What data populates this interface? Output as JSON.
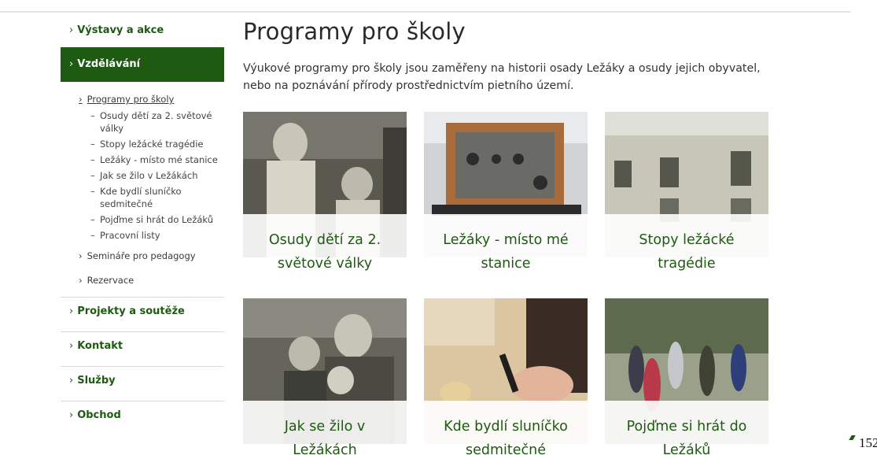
{
  "sidebar": {
    "items": [
      {
        "label": "Výstavy a akce"
      },
      {
        "label": "Vzdělávání"
      },
      {
        "label": "Projekty a soutěže"
      },
      {
        "label": "Kontakt"
      },
      {
        "label": "Služby"
      },
      {
        "label": "Obchod"
      }
    ],
    "sub": {
      "current": "Programy pro školy",
      "children": [
        "Osudy dětí za 2. světové války",
        "Stopy ležácké tragédie",
        "Ležáky - místo mé stanice",
        "Jak se žilo v Ležákách",
        "Kde bydlí sluníčko sedmitečné",
        "Pojďme si hrát do Ležáků",
        "Pracovní listy"
      ],
      "seminars": "Semináře pro pedagogy",
      "reservation": "Rezervace"
    },
    "chevron": "›"
  },
  "main": {
    "title": "Programy pro školy",
    "intro": "Výukové programy pro školy jsou zaměřeny na historii osady Ležáky a osudy jejich obyvatel, nebo na poznávání přírody prostřednictvím pietního území.",
    "cards": [
      {
        "title": "Osudy dětí za 2. světové války",
        "image": "vintage-photo-two-children"
      },
      {
        "title": "Ležáky - místo mé stanice",
        "image": "radio-transmitter-photo"
      },
      {
        "title": "Stopy ležácké tragédie",
        "image": "ruined-building-photo"
      },
      {
        "title": "Jak se žilo v Ležákách",
        "image": "vintage-family-photo"
      },
      {
        "title": "Kde bydlí sluníčko sedmitečné",
        "image": "child-drawing-photo"
      },
      {
        "title": "Pojďme si hrát do Ležáků",
        "image": "children-playing-circle-photo"
      }
    ]
  },
  "page_number": "152",
  "colors": {
    "accent": "#1e5a12",
    "divider": "#d7d7d7"
  }
}
